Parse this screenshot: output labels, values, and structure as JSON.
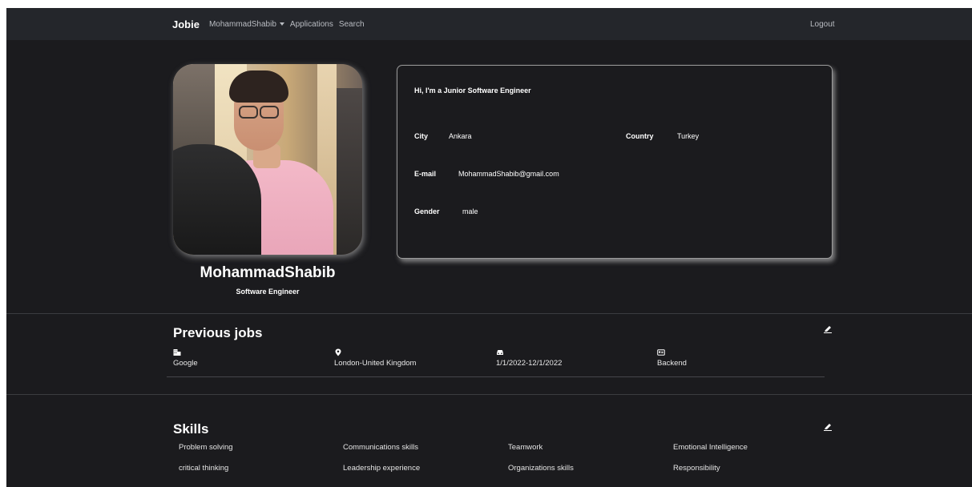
{
  "navbar": {
    "brand": "Jobie",
    "user_menu_label": "MohammadShabib",
    "applications_label": "Applications",
    "search_label": "Search",
    "logout_label": "Logout"
  },
  "profile": {
    "name": "MohammadShabib",
    "title": "Software Engineer"
  },
  "info": {
    "headline": "Hi, I'm a Junior Software Engineer",
    "city_label": "City",
    "city_value": "Ankara",
    "country_label": "Country",
    "country_value": "Turkey",
    "email_label": "E-mail",
    "email_value": "MohammadShabib@gmail.com",
    "gender_label": "Gender",
    "gender_value": "male"
  },
  "previous_jobs": {
    "title": "Previous jobs",
    "items": [
      {
        "icon": "building-icon",
        "value": "Google"
      },
      {
        "icon": "location-pin-icon",
        "value": "London-United Kingdom"
      },
      {
        "icon": "car-icon",
        "value": "1/1/2022-12/1/2022"
      },
      {
        "icon": "id-card-icon",
        "value": "Backend"
      }
    ]
  },
  "skills": {
    "title": "Skills",
    "items": [
      "Problem solving",
      "Communications skills",
      "Teamwork",
      "Emotional Intelligence",
      "critical thinking",
      "Leadership experience",
      "Organizations skills",
      "Responsibility"
    ]
  },
  "colors": {
    "page_background": "#1b1b1e",
    "navbar_background": "#24262b",
    "text": "#ffffff",
    "muted_text": "#b9bcc2"
  }
}
